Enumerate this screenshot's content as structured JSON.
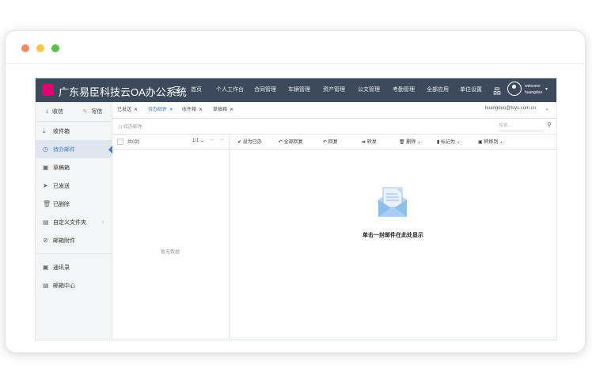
{
  "colors": {
    "browser_dot_red": "#ef8a63",
    "browser_dot_yellow": "#f7c646",
    "browser_dot_green": "#5ac24a",
    "header_bg": "#3d4a5c",
    "accent": "#3a7dc8",
    "logo": "#e4006f"
  },
  "app": {
    "title": "广东易臣科技云OA办公系统",
    "menu_icon": "menu-icon",
    "org_icon": "org-chart-icon",
    "user": {
      "avatar_icon": "user-avatar-icon",
      "welcome": "welcome",
      "name": "huangduo",
      "caret": "▾"
    }
  },
  "nav": [
    "首页",
    "个人工作台",
    "合同管理",
    "车辆管理",
    "资产管理",
    "公文管理",
    "考勤管理",
    "全部应用",
    "单位设置"
  ],
  "sidebar": {
    "receive": "收信",
    "compose": "写信",
    "items": [
      {
        "label": "收件箱",
        "icon": "⤓"
      },
      {
        "label": "待办邮件",
        "icon": "◷"
      },
      {
        "label": "草稿箱",
        "icon": "▣"
      },
      {
        "label": "已发送",
        "icon": "➤"
      },
      {
        "label": "已删除",
        "icon": "🗑"
      },
      {
        "label": "自定义文件夹",
        "icon": "▤",
        "chevron": "›"
      },
      {
        "label": "邮箱附件",
        "icon": "⊘"
      }
    ],
    "items2": [
      {
        "label": "通讯录",
        "icon": "▣"
      },
      {
        "label": "邮箱中心",
        "icon": "▤"
      }
    ]
  },
  "tabs": {
    "items": [
      {
        "label": "已发送",
        "close": "✕"
      },
      {
        "label": "待办邮件",
        "close": "✕"
      },
      {
        "label": "收件箱",
        "close": "✕"
      },
      {
        "label": "草稿箱",
        "close": "✕"
      }
    ],
    "account": "huangduo@tsys.com.cn",
    "account_chevron": "⌄"
  },
  "toolbar": {
    "breadcrumb": "待办邮件",
    "breadcrumb_icon": "◷",
    "search_placeholder": "搜索...",
    "search_icon": "⚲"
  },
  "list": {
    "count": "共0封",
    "page": "1/1 ⌄",
    "prev": "←",
    "next": "→",
    "empty": "暂无数据"
  },
  "actions": [
    {
      "label": "设为已办",
      "icon": "✔"
    },
    {
      "label": "全部回复",
      "icon": "↶"
    },
    {
      "label": "回复",
      "icon": "↶"
    },
    {
      "label": "转发",
      "icon": "➡"
    },
    {
      "label": "删除 ⌄",
      "icon": "🗑"
    },
    {
      "label": "标记为 ⌄",
      "icon": "▮"
    },
    {
      "label": "转移到 ⌄",
      "icon": "▣"
    }
  ],
  "preview": {
    "empty_text": "单击一封邮件在此处显示",
    "icon": "envelope-open-icon"
  }
}
